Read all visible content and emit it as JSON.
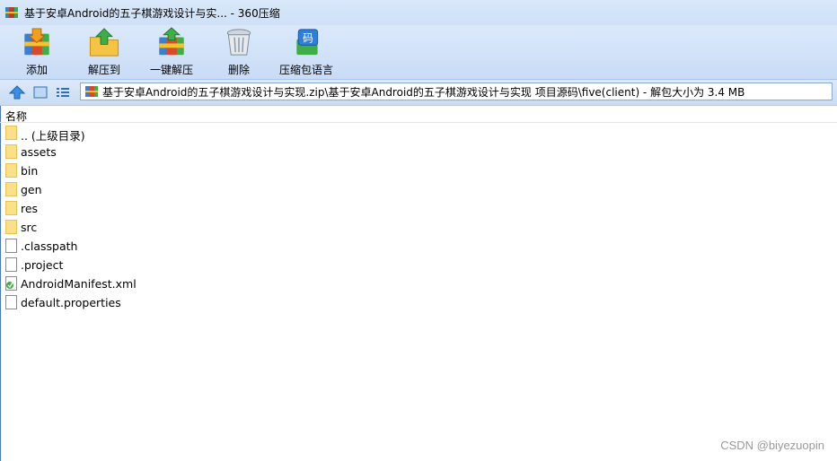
{
  "window": {
    "title": "基于安卓Android的五子棋游戏设计与实... - 360压缩"
  },
  "toolbar": {
    "items": [
      {
        "label": "添加",
        "icon": "add-icon"
      },
      {
        "label": "解压到",
        "icon": "extract-to-icon"
      },
      {
        "label": "一键解压",
        "icon": "one-click-extract-icon"
      },
      {
        "label": "删除",
        "icon": "delete-icon"
      },
      {
        "label": "压缩包语言",
        "icon": "archive-language-icon"
      }
    ]
  },
  "address": {
    "path": "基于安卓Android的五子棋游戏设计与实现.zip\\基于安卓Android的五子棋游戏设计与实现 项目源码\\five(client) - 解包大小为 3.4 MB"
  },
  "list": {
    "column_name": "名称",
    "items": [
      {
        "name": ".. (上级目录)",
        "type": "folder"
      },
      {
        "name": "assets",
        "type": "folder"
      },
      {
        "name": "bin",
        "type": "folder"
      },
      {
        "name": "gen",
        "type": "folder"
      },
      {
        "name": "res",
        "type": "folder"
      },
      {
        "name": "src",
        "type": "folder"
      },
      {
        "name": ".classpath",
        "type": "file"
      },
      {
        "name": ".project",
        "type": "file"
      },
      {
        "name": "AndroidManifest.xml",
        "type": "xml"
      },
      {
        "name": "default.properties",
        "type": "file"
      }
    ]
  },
  "watermark": "CSDN @biyezuopin"
}
